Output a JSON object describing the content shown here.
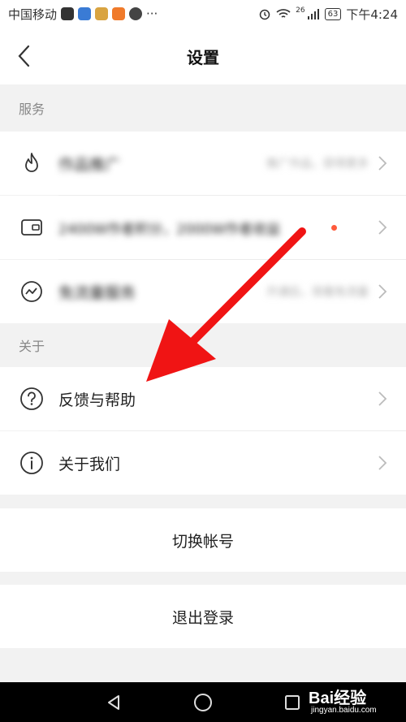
{
  "status_bar": {
    "carrier": "中国移动",
    "extra": "···",
    "network": "26",
    "battery": "63",
    "time": "下午4:24"
  },
  "header": {
    "title": "设置"
  },
  "sections": {
    "service": "服务",
    "about": "关于"
  },
  "service_rows": [
    {
      "label": "作品推广",
      "value": "推广作品，获得更多"
    },
    {
      "label": "2400W作者积分，2000W作者收益"
    },
    {
      "label": "免流量服务",
      "value": "开通后，观看免流量"
    }
  ],
  "about_rows": [
    {
      "label": "反馈与帮助"
    },
    {
      "label": "关于我们"
    }
  ],
  "actions": {
    "switch_account": "切换帐号",
    "logout": "退出登录"
  },
  "watermark": {
    "brand": "Bai经验",
    "url": "jingyan.baidu.com"
  },
  "colors": {
    "arrow": "#f01414",
    "accent_dot": "#ff5a3c"
  }
}
